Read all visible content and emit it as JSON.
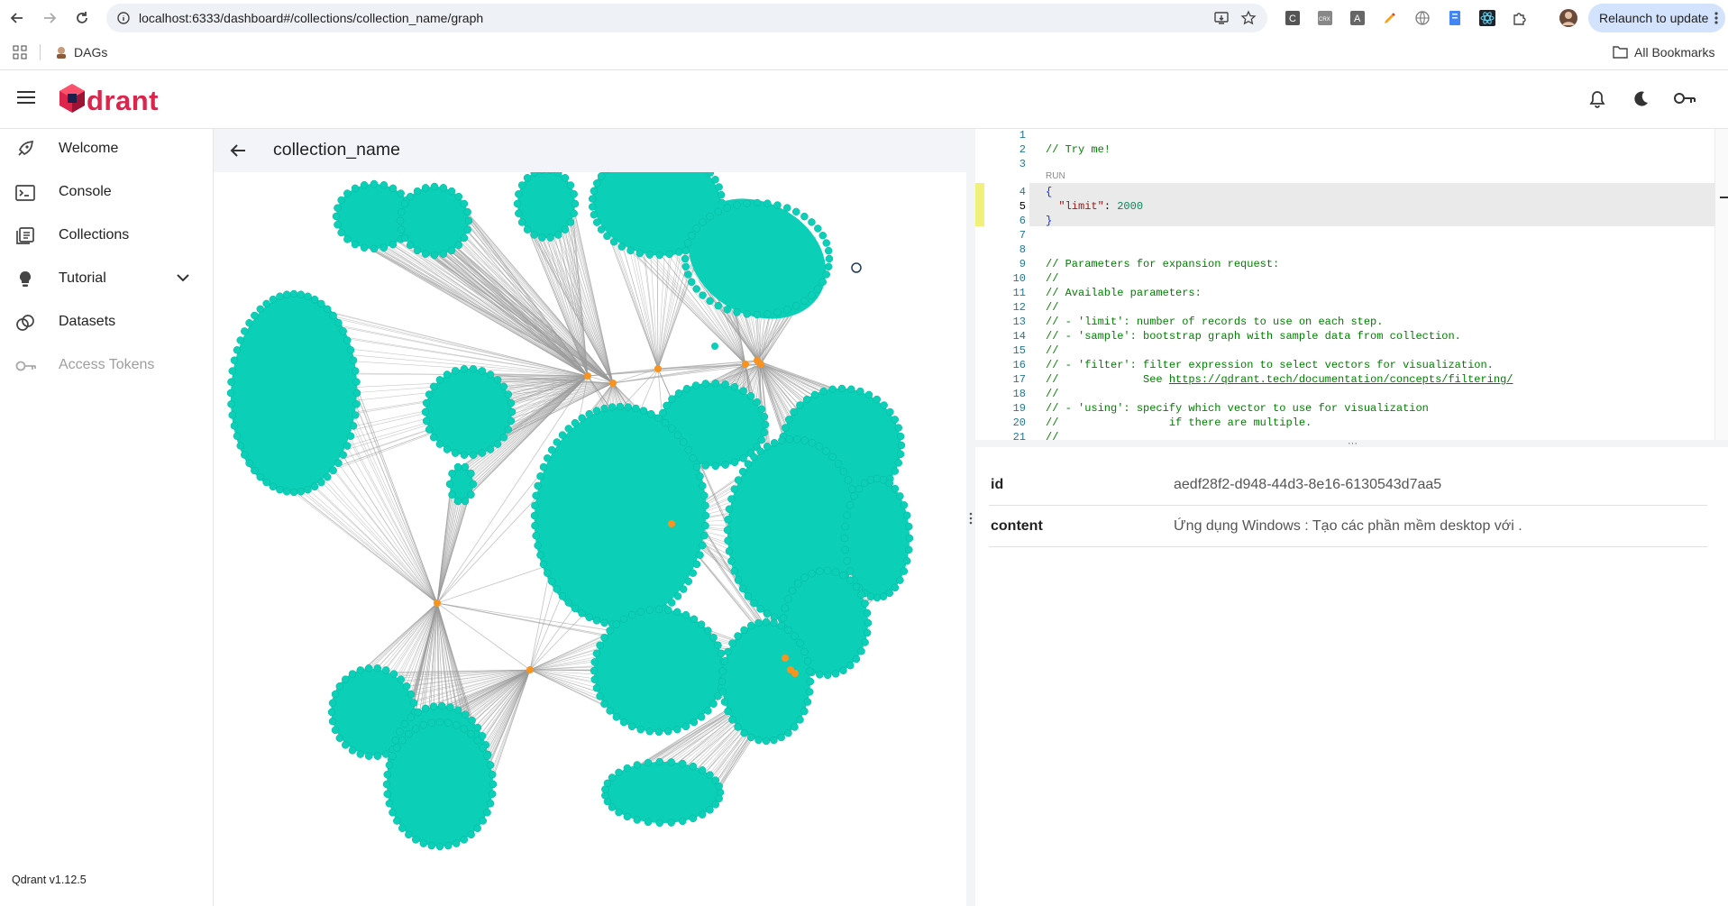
{
  "browser": {
    "url": "localhost:6333/dashboard#/collections/collection_name/graph",
    "relaunch_label": "Relaunch to update",
    "bookmark_dags": "DAGs",
    "all_bookmarks": "All Bookmarks"
  },
  "app": {
    "logo_text": "drant",
    "version": "Qdrant v1.12.5"
  },
  "sidebar": {
    "items": [
      {
        "label": "Welcome",
        "icon": "rocket-icon"
      },
      {
        "label": "Console",
        "icon": "terminal-icon"
      },
      {
        "label": "Collections",
        "icon": "collections-icon"
      },
      {
        "label": "Tutorial",
        "icon": "lightbulb-icon"
      },
      {
        "label": "Datasets",
        "icon": "datasets-icon"
      },
      {
        "label": "Access Tokens",
        "icon": "key-icon"
      }
    ]
  },
  "main": {
    "title": "collection_name"
  },
  "editor": {
    "run_label": "RUN",
    "lines": [
      "",
      "// Try me!",
      "",
      "{",
      "  \"limit\": 2000",
      "}",
      "",
      "",
      "// Parameters for expansion request:",
      "//",
      "// Available parameters:",
      "//",
      "// - 'limit': number of records to use on each step.",
      "// - 'sample': bootstrap graph with sample data from collection.",
      "//",
      "// - 'filter': filter expression to select vectors for visualization.",
      "//             See https://qdrant.tech/documentation/concepts/filtering/",
      "//",
      "// - 'using': specify which vector to use for visualization",
      "//                 if there are multiple.",
      "//"
    ],
    "limit_key": "\"limit\"",
    "limit_value": "2000",
    "see_prefix": "//             See ",
    "link": "https://qdrant.tech/documentation/concepts/filtering/"
  },
  "details": {
    "rows": [
      {
        "key": "id",
        "value": "aedf28f2-d948-44d3-8e16-6130543d7aa5"
      },
      {
        "key": "content",
        "value": "Ứng dụng Windows : Tạo các phần mềm desktop với ."
      }
    ]
  },
  "colors": {
    "node": "#0bcfb6",
    "hub": "#f7931e",
    "edge": "#9b9b9b",
    "brand": "#dc244c"
  }
}
